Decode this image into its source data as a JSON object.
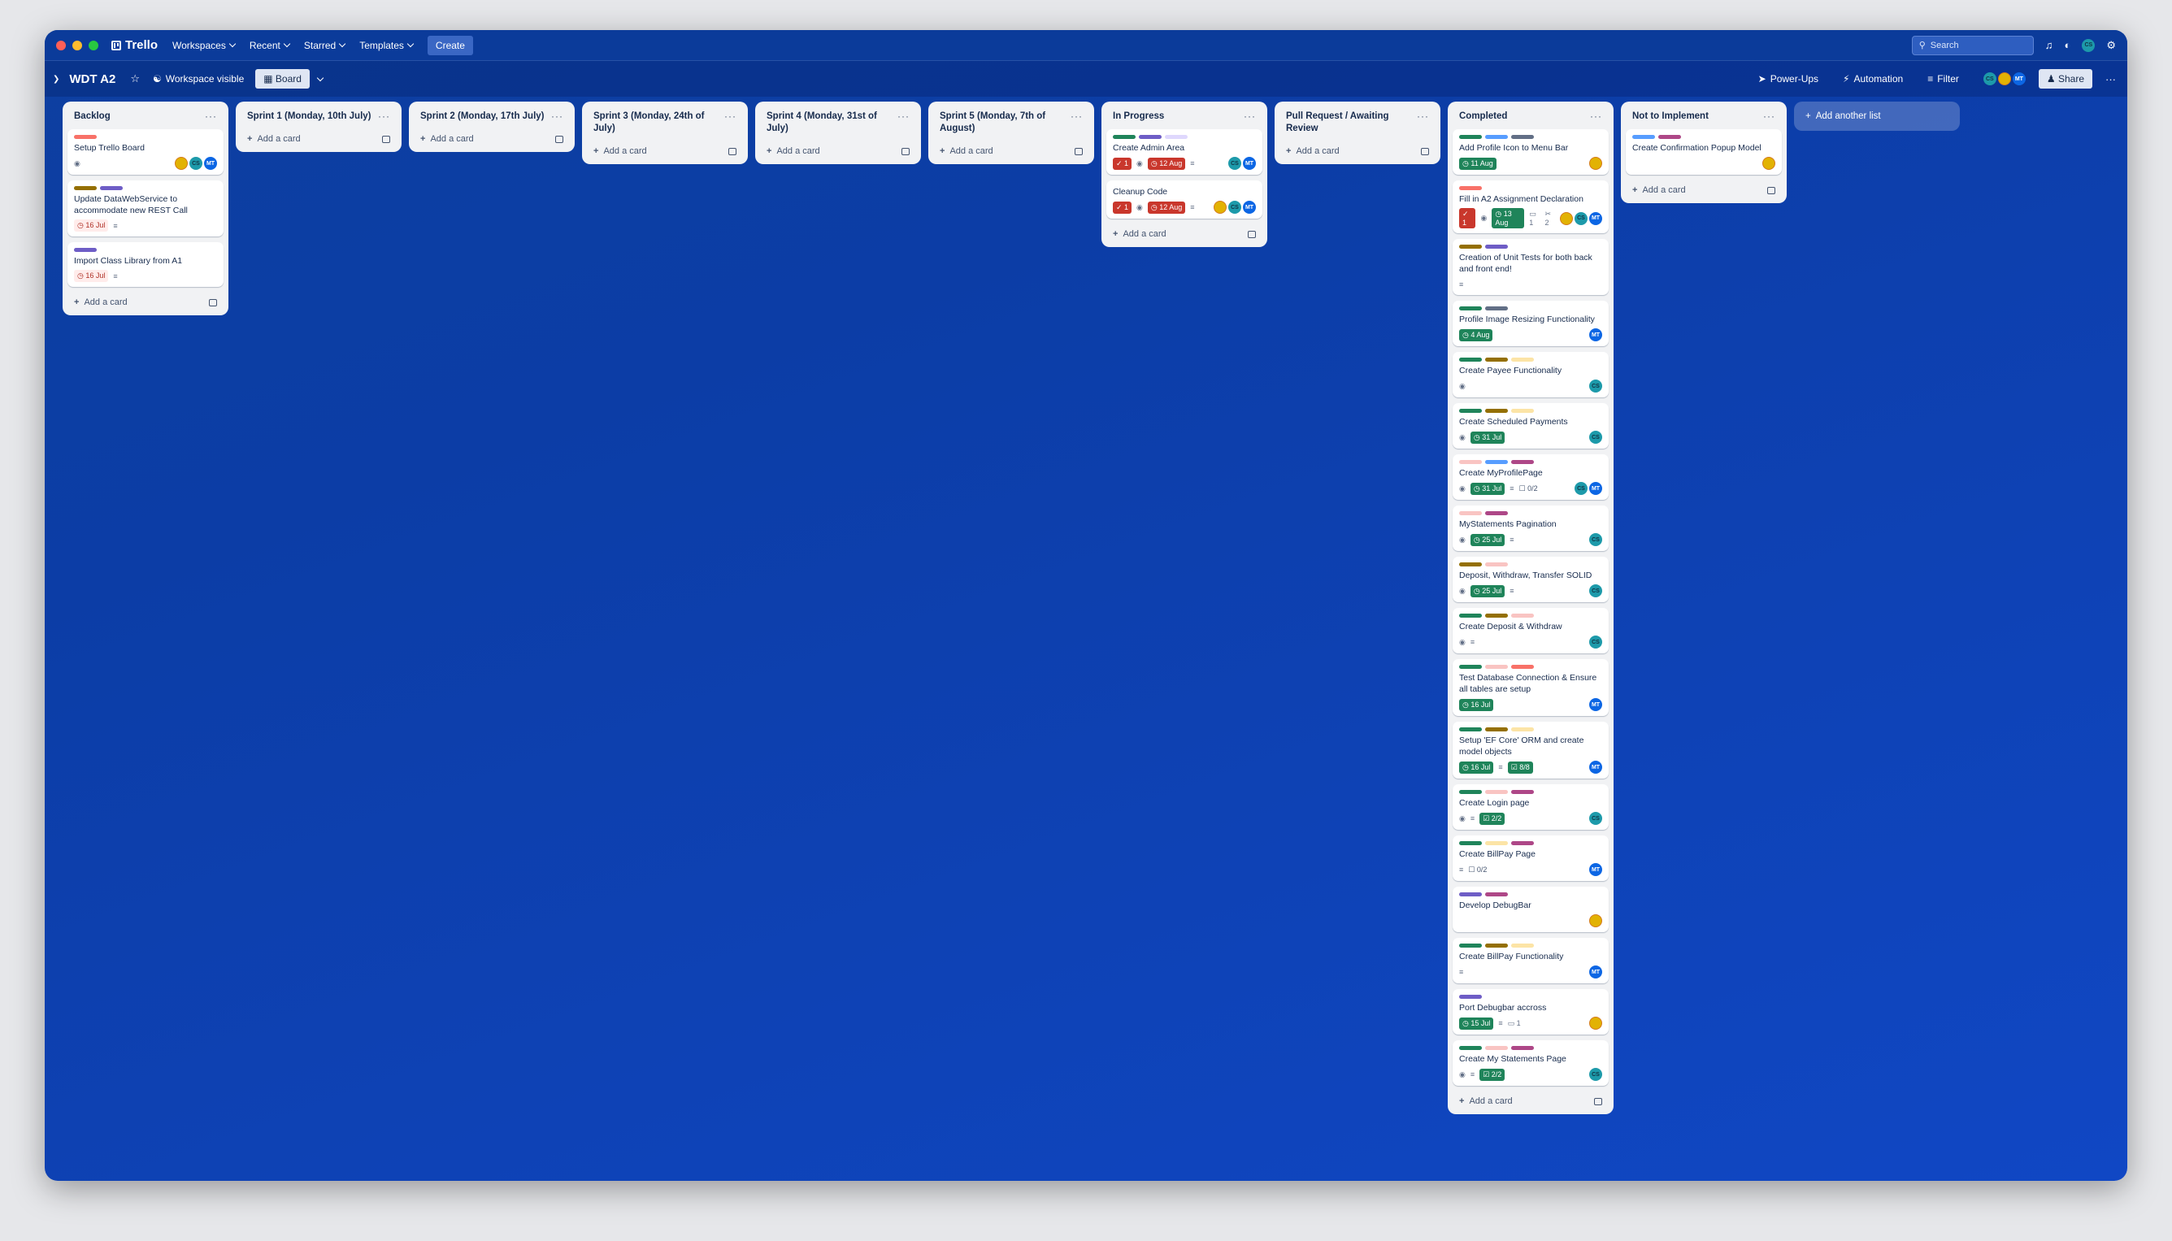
{
  "app": {
    "brand": "Trello",
    "nav": [
      "Workspaces",
      "Recent",
      "Starred",
      "Templates"
    ],
    "create_label": "Create",
    "search_placeholder": "Search"
  },
  "board": {
    "title": "WDT A2",
    "visibility": "Workspace visible",
    "view_label": "Board",
    "powerups": "Power-Ups",
    "automation": "Automation",
    "filter": "Filter",
    "share": "Share",
    "header_members": [
      "CS",
      "MT"
    ]
  },
  "colors": {
    "red": "#f87168",
    "purple": "#6e5dc6",
    "olive": "#946f00",
    "green": "#1f845a",
    "blue": "#579dff",
    "grey": "#626f86",
    "lavender": "#dfd8fd",
    "pink": "#ae4787",
    "salmon": "#fdd0ec",
    "peach": "#fce4a6",
    "rose": "#f9c4c2",
    "coral": "#f87168"
  },
  "add_card_label": "Add a card",
  "add_list_label": "Add another list",
  "lists": [
    {
      "title": "Backlog",
      "cards": [
        {
          "labels": [
            "red"
          ],
          "title": "Setup Trello Board",
          "badges": [
            {
              "t": "watch"
            }
          ],
          "members": [
            "ph",
            "CS",
            "MT"
          ]
        },
        {
          "labels": [
            "olive",
            "purple"
          ],
          "title": "Update DataWebService to accommodate new REST Call",
          "badges": [
            {
              "t": "due-light",
              "v": "16 Jul"
            },
            {
              "t": "desc"
            }
          ],
          "members": []
        },
        {
          "labels": [
            "purple"
          ],
          "title": "Import Class Library from A1",
          "badges": [
            {
              "t": "due-light",
              "v": "16 Jul"
            },
            {
              "t": "desc"
            }
          ],
          "members": []
        }
      ]
    },
    {
      "title": "Sprint 1 (Monday, 10th July)",
      "cards": []
    },
    {
      "title": "Sprint 2 (Monday, 17th July)",
      "cards": []
    },
    {
      "title": "Sprint 3 (Monday, 24th of July)",
      "cards": []
    },
    {
      "title": "Sprint 4 (Monday, 31st of July)",
      "cards": []
    },
    {
      "title": "Sprint 5 (Monday, 7th of August)",
      "cards": []
    },
    {
      "title": "In Progress",
      "cards": [
        {
          "labels": [
            "green",
            "purple",
            "lavender"
          ],
          "title": "Create Admin Area",
          "badges": [
            {
              "t": "vote",
              "v": "1"
            },
            {
              "t": "watch"
            },
            {
              "t": "due-red",
              "v": "12 Aug"
            },
            {
              "t": "desc"
            }
          ],
          "members": [
            "CS",
            "MT"
          ]
        },
        {
          "labels": [],
          "title": "Cleanup Code",
          "badges": [
            {
              "t": "vote",
              "v": "1"
            },
            {
              "t": "watch"
            },
            {
              "t": "due-red",
              "v": "12 Aug"
            },
            {
              "t": "desc"
            }
          ],
          "members": [
            "ph",
            "CS",
            "MT"
          ]
        }
      ]
    },
    {
      "title": "Pull Request / Awaiting Review",
      "cards": []
    },
    {
      "title": "Completed",
      "cards": [
        {
          "labels": [
            "green",
            "blue",
            "grey"
          ],
          "title": "Add Profile Icon to Menu Bar",
          "badges": [
            {
              "t": "due-green",
              "v": "11 Aug"
            }
          ],
          "members": [
            "ph"
          ]
        },
        {
          "labels": [
            "red"
          ],
          "title": "Fill in A2 Assignment Declaration",
          "badges": [
            {
              "t": "vote",
              "v": "1"
            },
            {
              "t": "watch"
            },
            {
              "t": "due-green",
              "v": "13 Aug"
            },
            {
              "t": "comments",
              "v": "1"
            },
            {
              "t": "attach",
              "v": "2"
            }
          ],
          "members": [
            "ph",
            "CS",
            "MT"
          ]
        },
        {
          "labels": [
            "olive",
            "purple"
          ],
          "title": "Creation of Unit Tests for both back and front end!",
          "badges": [
            {
              "t": "desc"
            }
          ],
          "members": []
        },
        {
          "labels": [
            "green",
            "grey"
          ],
          "title": "Profile Image Resizing Functionality",
          "badges": [
            {
              "t": "due-green",
              "v": "4 Aug"
            }
          ],
          "members": [
            "MT"
          ]
        },
        {
          "labels": [
            "green",
            "olive",
            "peach"
          ],
          "title": "Create Payee Functionality",
          "badges": [
            {
              "t": "watch"
            }
          ],
          "members": [
            "CS"
          ]
        },
        {
          "labels": [
            "green",
            "olive",
            "peach"
          ],
          "title": "Create Scheduled Payments",
          "badges": [
            {
              "t": "watch"
            },
            {
              "t": "due-green",
              "v": "31 Jul"
            }
          ],
          "members": [
            "CS"
          ]
        },
        {
          "labels": [
            "rose",
            "blue",
            "pink"
          ],
          "title": "Create MyProfilePage",
          "badges": [
            {
              "t": "watch"
            },
            {
              "t": "due-green",
              "v": "31 Jul"
            },
            {
              "t": "desc"
            },
            {
              "t": "check-plain",
              "v": "0/2"
            }
          ],
          "members": [
            "CS",
            "MT"
          ]
        },
        {
          "labels": [
            "rose",
            "pink"
          ],
          "title": "MyStatements Pagination",
          "badges": [
            {
              "t": "watch"
            },
            {
              "t": "due-green",
              "v": "25 Jul"
            },
            {
              "t": "desc"
            }
          ],
          "members": [
            "CS"
          ]
        },
        {
          "labels": [
            "olive",
            "rose"
          ],
          "title": "Deposit, Withdraw, Transfer SOLID",
          "badges": [
            {
              "t": "watch"
            },
            {
              "t": "due-green",
              "v": "25 Jul"
            },
            {
              "t": "desc"
            }
          ],
          "members": [
            "CS"
          ]
        },
        {
          "labels": [
            "green",
            "olive",
            "rose"
          ],
          "title": "Create Deposit & Withdraw",
          "badges": [
            {
              "t": "watch"
            },
            {
              "t": "desc"
            }
          ],
          "members": [
            "CS"
          ]
        },
        {
          "labels": [
            "green",
            "rose",
            "coral"
          ],
          "title": "Test Database Connection & Ensure all tables are setup",
          "badges": [
            {
              "t": "due-green",
              "v": "16 Jul"
            }
          ],
          "members": [
            "MT"
          ]
        },
        {
          "labels": [
            "green",
            "olive",
            "peach"
          ],
          "title": "Setup 'EF Core' ORM and create model objects",
          "badges": [
            {
              "t": "due-green",
              "v": "16 Jul"
            },
            {
              "t": "desc"
            },
            {
              "t": "check-green",
              "v": "8/8"
            }
          ],
          "members": [
            "MT"
          ]
        },
        {
          "labels": [
            "green",
            "rose",
            "pink"
          ],
          "title": "Create Login page",
          "badges": [
            {
              "t": "watch"
            },
            {
              "t": "desc"
            },
            {
              "t": "check-green",
              "v": "2/2"
            }
          ],
          "members": [
            "CS"
          ]
        },
        {
          "labels": [
            "green",
            "peach",
            "pink"
          ],
          "title": "Create BillPay Page",
          "badges": [
            {
              "t": "desc"
            },
            {
              "t": "check-plain",
              "v": "0/2"
            }
          ],
          "members": [
            "MT"
          ]
        },
        {
          "labels": [
            "purple",
            "pink"
          ],
          "title": "Develop DebugBar",
          "badges": [],
          "members": [
            "ph"
          ]
        },
        {
          "labels": [
            "green",
            "olive",
            "peach"
          ],
          "title": "Create BillPay Functionality",
          "badges": [
            {
              "t": "desc"
            }
          ],
          "members": [
            "MT"
          ]
        },
        {
          "labels": [
            "purple"
          ],
          "title": "Port Debugbar accross",
          "badges": [
            {
              "t": "due-green",
              "v": "15 Jul"
            },
            {
              "t": "desc"
            },
            {
              "t": "comments",
              "v": "1"
            }
          ],
          "members": [
            "ph"
          ]
        },
        {
          "labels": [
            "green",
            "rose",
            "pink"
          ],
          "title": "Create My Statements Page",
          "badges": [
            {
              "t": "watch"
            },
            {
              "t": "desc"
            },
            {
              "t": "check-green",
              "v": "2/2"
            }
          ],
          "members": [
            "CS"
          ]
        }
      ]
    },
    {
      "title": "Not to Implement",
      "cards": [
        {
          "labels": [
            "blue",
            "pink"
          ],
          "title": "Create Confirmation Popup Model",
          "badges": [],
          "members": [
            "ph"
          ]
        }
      ]
    }
  ]
}
